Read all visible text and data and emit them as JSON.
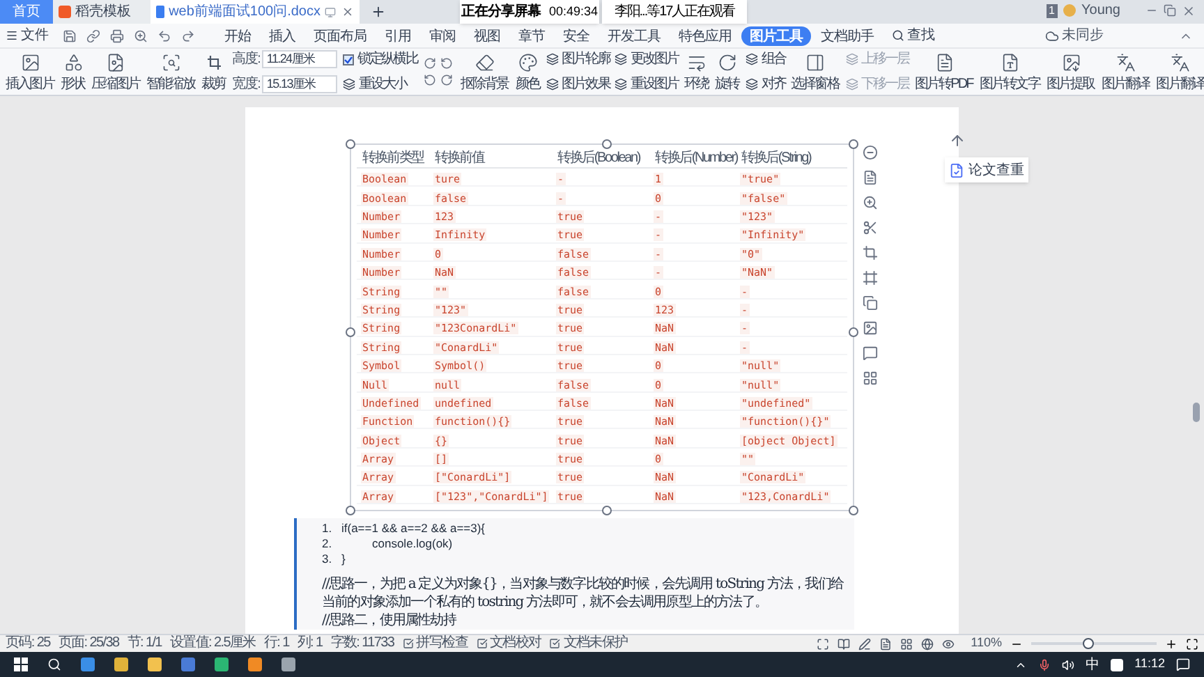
{
  "tabs": [
    {
      "label": "首页",
      "kind": "home",
      "selected": false
    },
    {
      "label": "稻壳模板",
      "kind": "template",
      "selected": false
    },
    {
      "label": "web前端面试100问.docx",
      "kind": "doc",
      "selected": true
    }
  ],
  "share": {
    "status": "正在分享屏幕",
    "timer": "00:49:34",
    "viewers": "李阳...等17人正在观看"
  },
  "account": {
    "badge": "1",
    "user": "Young"
  },
  "menu": {
    "file": "文件",
    "items": [
      {
        "label": "开始",
        "selected": false
      },
      {
        "label": "插入",
        "selected": false
      },
      {
        "label": "页面布局",
        "selected": false
      },
      {
        "label": "引用",
        "selected": false
      },
      {
        "label": "审阅",
        "selected": false
      },
      {
        "label": "视图",
        "selected": false
      },
      {
        "label": "章节",
        "selected": false
      },
      {
        "label": "安全",
        "selected": false
      },
      {
        "label": "开发工具",
        "selected": false
      },
      {
        "label": "特色应用",
        "selected": false
      },
      {
        "label": "图片工具",
        "selected": true
      },
      {
        "label": "文档助手",
        "selected": false
      }
    ],
    "search": "查找",
    "sync": "未同步"
  },
  "ribbon": [
    {
      "kind": "big",
      "label": "插入图片"
    },
    {
      "kind": "big",
      "label": "形状"
    },
    {
      "kind": "big",
      "label": "压缩图片"
    },
    {
      "kind": "big",
      "label": "智能缩放"
    },
    {
      "kind": "big",
      "label": "裁剪"
    },
    {
      "kind": "stack",
      "items": [
        {
          "kind": "field",
          "label": "高度:",
          "value": "11.24厘米"
        },
        {
          "kind": "field",
          "label": "宽度:",
          "value": "15.13厘米"
        }
      ]
    },
    {
      "kind": "stack",
      "items": [
        {
          "kind": "check",
          "label": "锁定纵横比",
          "checked": true
        },
        {
          "kind": "small",
          "label": "重设大小",
          "disabled": false
        }
      ]
    },
    {
      "kind": "rotate"
    },
    {
      "kind": "big",
      "label": "抠除背景"
    },
    {
      "kind": "big",
      "label": "颜色"
    },
    {
      "kind": "stack",
      "items": [
        {
          "kind": "small",
          "label": "图片轮廓",
          "disabled": false
        },
        {
          "kind": "small",
          "label": "图片效果",
          "disabled": false
        }
      ]
    },
    {
      "kind": "stack",
      "items": [
        {
          "kind": "small",
          "label": "更改图片",
          "disabled": false
        },
        {
          "kind": "small",
          "label": "重设图片",
          "disabled": false
        }
      ]
    },
    {
      "kind": "big",
      "label": "环绕"
    },
    {
      "kind": "big",
      "label": "旋转"
    },
    {
      "kind": "stack",
      "items": [
        {
          "kind": "small",
          "label": "组合",
          "disabled": false
        },
        {
          "kind": "small",
          "label": "对齐",
          "disabled": false
        }
      ]
    },
    {
      "kind": "big",
      "label": "选择窗格"
    },
    {
      "kind": "stack",
      "items": [
        {
          "kind": "small",
          "label": "上移一层",
          "disabled": true
        },
        {
          "kind": "small",
          "label": "下移一层",
          "disabled": true
        }
      ]
    },
    {
      "kind": "big",
      "label": "图片转PDF"
    },
    {
      "kind": "big",
      "label": "图片转文字"
    },
    {
      "kind": "big",
      "label": "图片提取"
    },
    {
      "kind": "big",
      "label": "图片翻译"
    },
    {
      "kind": "big",
      "label": "图片翻译"
    }
  ],
  "table": {
    "columns": [
      "转换前类型",
      "转换前值",
      "转换后(Boolean)",
      "转换后(Number)",
      "转换后(String)"
    ],
    "rows": [
      [
        "Boolean",
        "ture",
        "-",
        "1",
        "\"true\""
      ],
      [
        "Boolean",
        "false",
        "-",
        "0",
        "\"false\""
      ],
      [
        "Number",
        "123",
        "true",
        "-",
        "\"123\""
      ],
      [
        "Number",
        "Infinity",
        "true",
        "-",
        "\"Infinity\""
      ],
      [
        "Number",
        "0",
        "false",
        "-",
        "\"0\""
      ],
      [
        "Number",
        "NaN",
        "false",
        "-",
        "\"NaN\""
      ],
      [
        "String",
        "\"\"",
        "false",
        "0",
        "-"
      ],
      [
        "String",
        "\"123\"",
        "true",
        "123",
        "-"
      ],
      [
        "String",
        "\"123ConardLi\"",
        "true",
        "NaN",
        "-"
      ],
      [
        "String",
        "\"ConardLi\"",
        "true",
        "NaN",
        "-"
      ],
      [
        "Symbol",
        "Symbol()",
        "true",
        "0",
        "\"null\""
      ],
      [
        "Null",
        "null",
        "false",
        "0",
        "\"null\""
      ],
      [
        "Undefined",
        "undefined",
        "false",
        "NaN",
        "\"undefined\""
      ],
      [
        "Function",
        "function(){}",
        "true",
        "NaN",
        "\"function(){}\""
      ],
      [
        "Object",
        "{}",
        "true",
        "NaN",
        "[object Object]"
      ],
      [
        "Array",
        "[]",
        "true",
        "0",
        "\"\""
      ],
      [
        "Array",
        "[\"ConardLi\"]",
        "true",
        "NaN",
        "\"ConardLi\""
      ],
      [
        "Array",
        "[\"123\",\"ConardLi\"]",
        "true",
        "NaN",
        "\"123,ConardLi\""
      ]
    ]
  },
  "code": [
    {
      "num": "1.",
      "text": "if(a==1 && a==2 && a==3){"
    },
    {
      "num": "2.",
      "text": "console.log(ok)"
    },
    {
      "num": "3.",
      "text": "}"
    }
  ],
  "paragraphs": [
    "//思路一，为把 a 定义为对象{}，当对象与数字比较的时候，会先调用 toString 方法，我们给当前的对象添加一个私有的 tostring 方法即可，就不会去调用原型上的方法了。",
    "//思路二，使用属性劫持"
  ],
  "side_panel": {
    "label": "论文查重"
  },
  "status": {
    "fields": [
      "页码: 25",
      "页面: 25/38",
      "节: 1/1",
      "设置值: 2.5厘米",
      "行: 1",
      "列: 1",
      "字数: 11733"
    ],
    "tools": [
      "拼写检查",
      "文档校对",
      "文档未保护"
    ],
    "zoom": {
      "label": "110%",
      "level": 0.45
    }
  },
  "taskbar": {
    "ime": "中",
    "time": "11:12"
  }
}
